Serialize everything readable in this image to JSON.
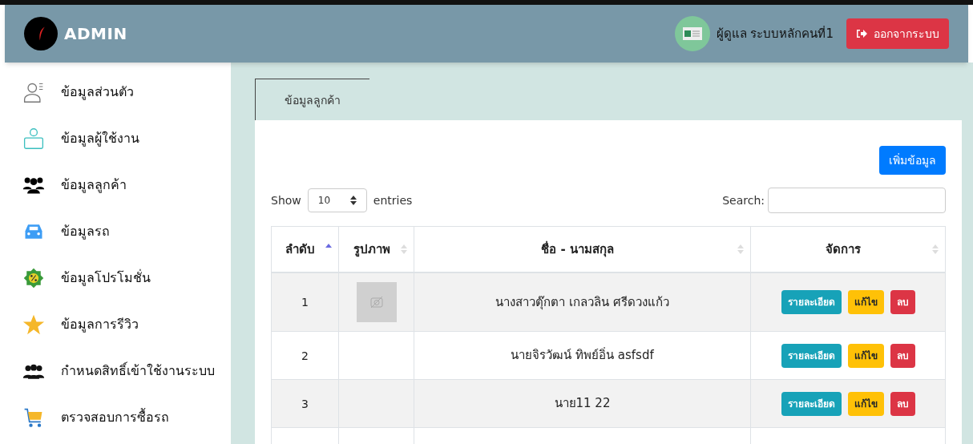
{
  "header": {
    "brand": "ADMIN",
    "user": "ผู้ดูแล ระบบหลักคนที่1",
    "logout": "ออกจากระบบ"
  },
  "sidebar": {
    "items": [
      {
        "label": "ข้อมูลส่วนตัว",
        "kind": "profile"
      },
      {
        "label": "ข้อมูลผู้ใช้งาน",
        "kind": "user"
      },
      {
        "label": "ข้อมูลลูกค้า",
        "kind": "customers"
      },
      {
        "label": "ข้อมูลรถ",
        "kind": "car"
      },
      {
        "label": "ข้อมูลโปรโมชั่น",
        "kind": "promo"
      },
      {
        "label": "ข้อมูลการรีวิว",
        "kind": "star"
      },
      {
        "label": "กำหนดสิทธิ์เข้าใช้งานระบบ",
        "kind": "group"
      },
      {
        "label": "ตรวจสอบการซื้อรถ",
        "kind": "cart"
      }
    ]
  },
  "tabs": [
    {
      "label": "ข้อมูลลูกค้า",
      "selected": true
    }
  ],
  "add_button": "เพิ่มข้อมูล",
  "length": {
    "before": "Show",
    "value": "10",
    "after": "entries"
  },
  "search": {
    "label": "Search:"
  },
  "table": {
    "columns": [
      {
        "label": "ลำดับ",
        "sorted": true
      },
      {
        "label": "รูปภาพ",
        "sorted": false
      },
      {
        "label": "ชื่อ - นามสกุล",
        "sorted": false
      },
      {
        "label": "จัดการ",
        "sorted": false
      }
    ],
    "rows": [
      {
        "no": "1",
        "image": true,
        "name": "นางสาวตุ๊กตา เกลวลิน ศรีดวงแก้ว",
        "actions": [
          "รายละเอียด",
          "แก้ไข",
          "ลบ"
        ]
      },
      {
        "no": "2",
        "image": false,
        "name": "นายจิรวัฒน์ ทิพย์อิ่น asfsdf",
        "actions": [
          "รายละเอียด",
          "แก้ไข",
          "ลบ"
        ]
      },
      {
        "no": "3",
        "image": false,
        "name": "นาย11 22",
        "actions": [
          "รายละเอียด",
          "แก้ไข",
          "ลบ"
        ]
      }
    ]
  }
}
